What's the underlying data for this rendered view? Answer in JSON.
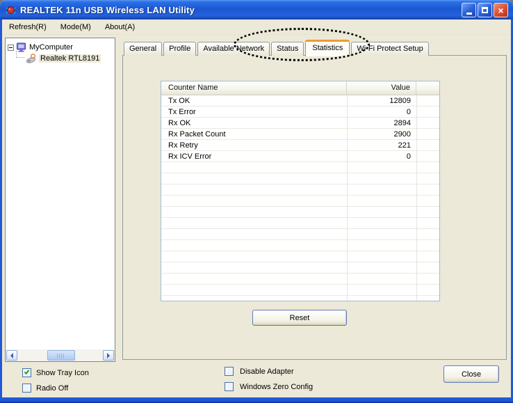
{
  "window": {
    "title": "REALTEK 11n USB Wireless LAN Utility",
    "icon": "realtek-crab-logo"
  },
  "menu": {
    "items": [
      "Refresh(R)",
      "Mode(M)",
      "About(A)"
    ]
  },
  "tree": {
    "root": "MyComputer",
    "child": "Realtek RTL8191"
  },
  "tabs": {
    "items": [
      "General",
      "Profile",
      "Available Network",
      "Status",
      "Statistics",
      "Wi-Fi Protect Setup"
    ],
    "active": "Statistics"
  },
  "annotation": {
    "shape": "dotted-ellipse",
    "highlights": "Status and Statistics tabs"
  },
  "table": {
    "headers": [
      "Counter Name",
      "Value"
    ],
    "rows": [
      [
        "Tx OK",
        "12809"
      ],
      [
        "Tx Error",
        "0"
      ],
      [
        "Rx OK",
        "2894"
      ],
      [
        "Rx Packet Count",
        "2900"
      ],
      [
        "Rx Retry",
        "221"
      ],
      [
        "Rx ICV Error",
        "0"
      ]
    ]
  },
  "buttons": {
    "reset": "Reset",
    "close": "Close"
  },
  "footer": {
    "checkboxes": [
      {
        "label": "Show Tray Icon",
        "checked": true
      },
      {
        "label": "Radio Off",
        "checked": false
      },
      {
        "label": "Disable Adapter",
        "checked": false
      },
      {
        "label": "Windows Zero Config",
        "checked": false
      }
    ]
  },
  "colors": {
    "titlebar_blue": "#1C56D0",
    "window_border": "#2158D6",
    "active_tab_accent": "#ED9B2F",
    "check_green": "#21A121",
    "dialog_background": "#ECE9D8"
  }
}
